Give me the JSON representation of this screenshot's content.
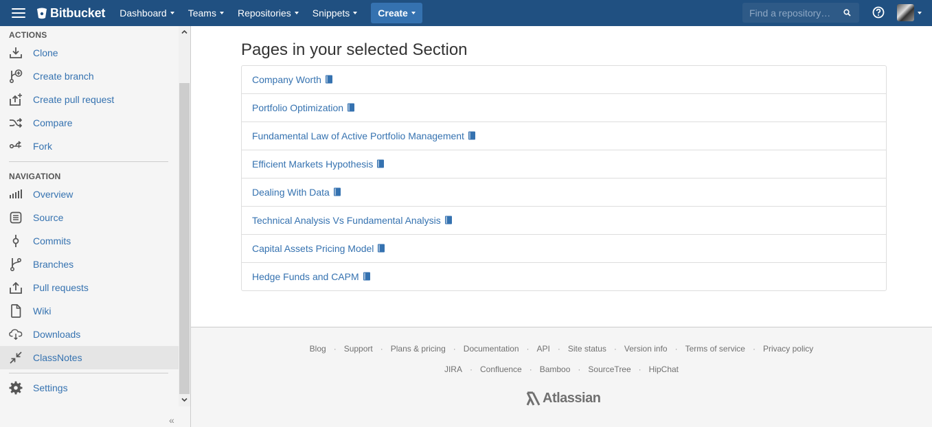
{
  "topbar": {
    "brand": "Bitbucket",
    "nav": [
      {
        "label": "Dashboard"
      },
      {
        "label": "Teams"
      },
      {
        "label": "Repositories"
      },
      {
        "label": "Snippets"
      }
    ],
    "create_label": "Create",
    "search_placeholder": "Find a repository…",
    "icons": {
      "menu": "hamburger-icon",
      "search": "search-icon",
      "help": "help-icon"
    }
  },
  "sidebar": {
    "actions_heading": "ACTIONS",
    "actions": [
      {
        "label": "Clone",
        "icon": "download-icon"
      },
      {
        "label": "Create branch",
        "icon": "branch-add-icon"
      },
      {
        "label": "Create pull request",
        "icon": "pull-request-create-icon"
      },
      {
        "label": "Compare",
        "icon": "shuffle-icon"
      },
      {
        "label": "Fork",
        "icon": "fork-icon"
      }
    ],
    "navigation_heading": "NAVIGATION",
    "navigation": [
      {
        "label": "Overview",
        "icon": "bar-chart-icon"
      },
      {
        "label": "Source",
        "icon": "source-file-icon"
      },
      {
        "label": "Commits",
        "icon": "commit-icon"
      },
      {
        "label": "Branches",
        "icon": "branch-icon"
      },
      {
        "label": "Pull requests",
        "icon": "pull-request-icon"
      },
      {
        "label": "Wiki",
        "icon": "page-icon"
      },
      {
        "label": "Downloads",
        "icon": "cloud-download-icon"
      },
      {
        "label": "ClassNotes",
        "icon": "collapse-arrows-icon",
        "active": true
      }
    ],
    "settings_label": "Settings",
    "collapse_label": "«"
  },
  "main": {
    "title": "Pages in your selected Section",
    "pages": [
      {
        "label": "Company Worth"
      },
      {
        "label": "Portfolio Optimization"
      },
      {
        "label": "Fundamental Law of Active Portfolio Management"
      },
      {
        "label": "Efficient Markets Hypothesis"
      },
      {
        "label": "Dealing With Data"
      },
      {
        "label": "Technical Analysis Vs Fundamental Analysis"
      },
      {
        "label": "Capital Assets Pricing Model"
      },
      {
        "label": "Hedge Funds and CAPM"
      }
    ]
  },
  "footer": {
    "links_row1": [
      "Blog",
      "Support",
      "Plans & pricing",
      "Documentation",
      "API",
      "Site status",
      "Version info",
      "Terms of service",
      "Privacy policy"
    ],
    "links_row2": [
      "JIRA",
      "Confluence",
      "Bamboo",
      "SourceTree",
      "HipChat"
    ],
    "logo_text": "Atlassian"
  },
  "colors": {
    "topbar": "#205081",
    "link": "#3572b0",
    "create_button": "#3572b0"
  }
}
